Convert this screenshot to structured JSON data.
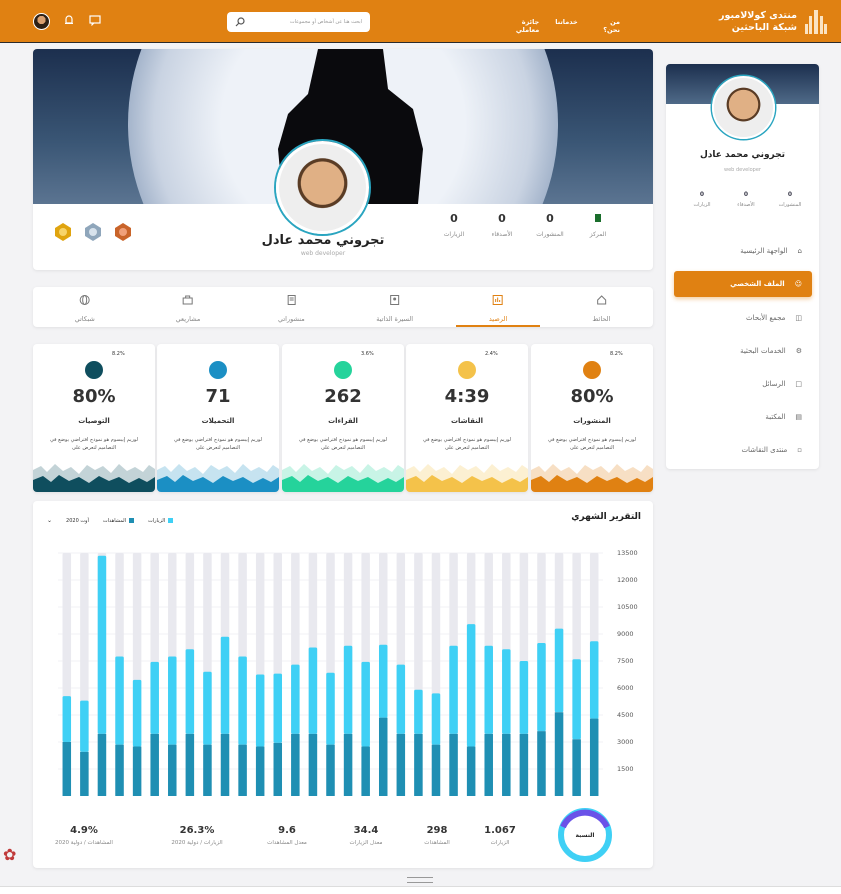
{
  "brand": {
    "line1": "منتدى كولالامبور",
    "line2": "شبكة الباحثين"
  },
  "nav": [
    "من نحن؟",
    "خدماتنا",
    "جائزة معاملي"
  ],
  "search": {
    "placeholder": "ابحث هنا عن أشخاص أو مجموعات"
  },
  "profile": {
    "name": "تجروني محمد عادل",
    "role": "web developer"
  },
  "stats": [
    {
      "label": "المركز",
      "value": ""
    },
    {
      "label": "المنشورات",
      "value": "0"
    },
    {
      "label": "الأصدقاء",
      "value": "0"
    },
    {
      "label": "الزيارات",
      "value": "0"
    }
  ],
  "tabs": [
    {
      "label": "الحائط"
    },
    {
      "label": "الرصيد"
    },
    {
      "label": "السيرة الذاتية"
    },
    {
      "label": "منشوراتي"
    },
    {
      "label": "مشاريعي"
    },
    {
      "label": "شبكاتي"
    }
  ],
  "colors": {
    "accent": "#e08112",
    "bar_dark": "#1f8fb3",
    "bar_light": "#3fd0f5"
  },
  "cards": [
    {
      "title": "المنشورات",
      "value": "80%",
      "pct": "8.2%",
      "desc": "لوريم إيبسوم هو نموذج افتراضي يوضع في التصاميم لتعرض على",
      "color": "#e08112",
      "icon": "document-icon"
    },
    {
      "title": "النقاشات",
      "value": "4:39",
      "pct": "2.4%",
      "desc": "لوريم إيبسوم هو نموذج افتراضي يوضع في التصاميم لتعرض على",
      "color": "#f4c24a",
      "icon": "chat-icon"
    },
    {
      "title": "القراءات",
      "value": "262",
      "pct": "3.6%",
      "desc": "لوريم إيبسوم هو نموذج افتراضي يوضع في التصاميم لتعرض على",
      "color": "#25d39b",
      "icon": "book-icon"
    },
    {
      "title": "التحميلات",
      "value": "71",
      "pct": "",
      "desc": "لوريم إيبسوم هو نموذج افتراضي يوضع في التصاميم لتعرض على",
      "color": "#1b8fc4",
      "icon": "cloud-download-icon"
    },
    {
      "title": "التوصيات",
      "value": "80%",
      "pct": "8.2%",
      "desc": "لوريم إيبسوم هو نموذج افتراضي يوضع في التصاميم لتعرض على",
      "color": "#0f4e5e",
      "icon": "award-icon"
    }
  ],
  "report": {
    "title": "التقرير الشهري",
    "period": "أوت 2020",
    "ratio_label": "النسبة"
  },
  "chart_data": {
    "type": "bar",
    "series": [
      {
        "name": "الزيارات",
        "values": [
          4300,
          3150,
          4650,
          3600,
          3450,
          3450,
          3450,
          2750,
          3450,
          2850,
          3450,
          3450,
          4350,
          2750,
          3450,
          2850,
          3450,
          3450,
          2950,
          2750,
          2850,
          3450,
          2850,
          3450,
          2850,
          3450,
          2750,
          2850,
          3450,
          2450,
          3000
        ]
      },
      {
        "name": "المشاهدات",
        "values": [
          4300,
          4450,
          4650,
          4900,
          4050,
          4700,
          4900,
          6800,
          4900,
          2850,
          2450,
          3850,
          4050,
          4700,
          4900,
          4000,
          4800,
          3850,
          3850,
          4000,
          4900,
          5400,
          4050,
          4700,
          4900,
          4000,
          3700,
          4900,
          9900,
          2850,
          2550
        ]
      }
    ],
    "yticks": [
      1500,
      3000,
      4500,
      6000,
      7500,
      9000,
      10500,
      12000,
      13500
    ],
    "ylim": [
      0,
      13500
    ]
  },
  "bottom_stats": [
    {
      "value": "1.067",
      "label": "الزيارات"
    },
    {
      "value": "298",
      "label": "المشاهدات"
    },
    {
      "value": "34.4",
      "label": "معدل الزيارات"
    },
    {
      "value": "9.6",
      "label": "معدل المشاهدات"
    },
    {
      "value": "26.3%",
      "label": "الزيارات / دولية 2020"
    },
    {
      "value": "4.9%",
      "label": "المشاهدات / دولية 2020"
    }
  ],
  "sidebar": {
    "name": "تجروني محمد عادل",
    "role": "web developer",
    "stats": [
      {
        "label": "المنشورات",
        "value": "0"
      },
      {
        "label": "الأصدقاء",
        "value": "0"
      },
      {
        "label": "الزيارات",
        "value": "0"
      }
    ],
    "menu": [
      {
        "label": "الواجهة الرئيسية",
        "icon": "home-icon"
      },
      {
        "label": "الملف الشخصي",
        "icon": "user-icon"
      },
      {
        "label": "مجمع الأبحاث",
        "icon": "research-icon"
      },
      {
        "label": "الخدمات البحثية",
        "icon": "services-icon"
      },
      {
        "label": "الرسائل",
        "icon": "messages-icon"
      },
      {
        "label": "المكتبة",
        "icon": "library-icon"
      },
      {
        "label": "منتدى النقاشات",
        "icon": "forum-icon"
      }
    ]
  }
}
